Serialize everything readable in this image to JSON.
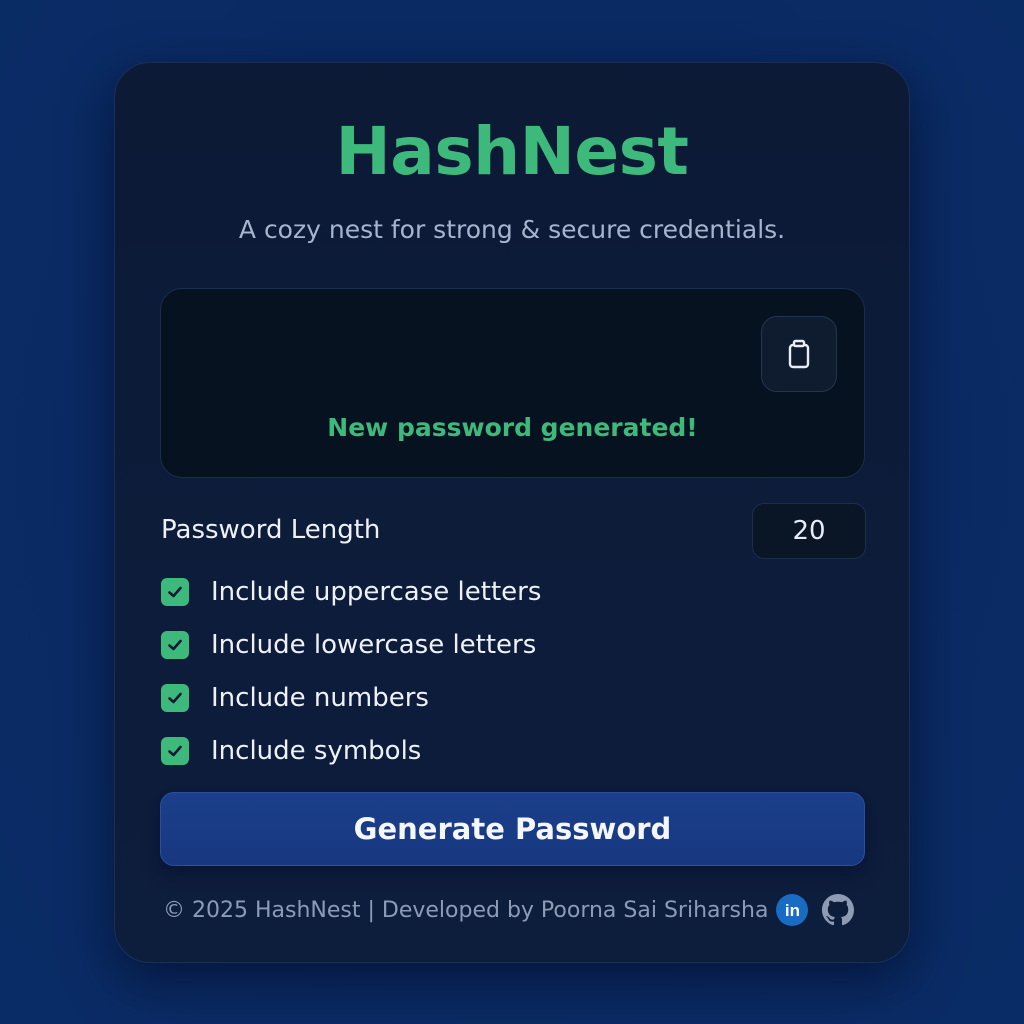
{
  "app": {
    "title": "HashNest",
    "subtitle": "A cozy nest for strong & secure credentials."
  },
  "output": {
    "password": "",
    "status": "New password generated!",
    "copy_icon": "clipboard-icon"
  },
  "settings": {
    "length_label": "Password Length",
    "length_value": "20",
    "options": [
      {
        "label": "Include uppercase letters",
        "checked": true
      },
      {
        "label": "Include lowercase letters",
        "checked": true
      },
      {
        "label": "Include numbers",
        "checked": true
      },
      {
        "label": "Include symbols",
        "checked": true
      }
    ]
  },
  "actions": {
    "generate_label": "Generate Password"
  },
  "footer": {
    "text": "© 2025 HashNest | Developed by Poorna Sai Sriharsha",
    "linkedin_text": "in",
    "icons": [
      "linkedin-icon",
      "github-icon"
    ]
  },
  "colors": {
    "accent": "#3dba7b",
    "page_background": "#0a2a5e",
    "card_background": "#0c1a36",
    "button": "#1c3f8b",
    "linkedin": "#1a6bc2"
  }
}
